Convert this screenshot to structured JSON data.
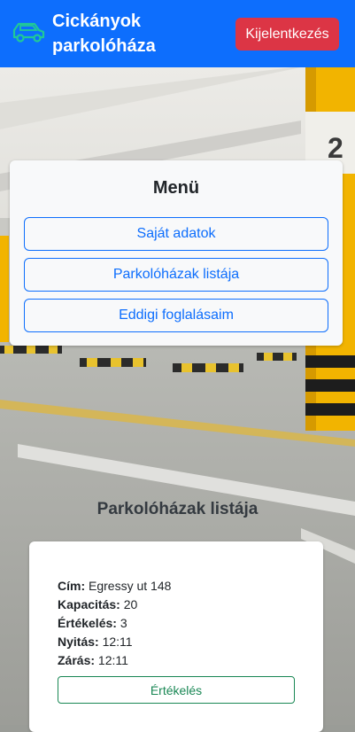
{
  "header": {
    "brand_line1": "Cickányok",
    "brand_line2": "parkolóháza",
    "brand_icon": "car-icon",
    "logout_label": "Kijelentkezés"
  },
  "menu": {
    "title": "Menü",
    "items": [
      {
        "label": "Saját adatok"
      },
      {
        "label": "Parkolóházak listája"
      },
      {
        "label": "Eddigi foglalásaim"
      }
    ]
  },
  "list": {
    "title": "Parkolóházak listája",
    "garages": [
      {
        "address_label": "Cím:",
        "address": "Egressy ut 148",
        "capacity_label": "Kapacitás:",
        "capacity": "20",
        "rating_label": "Értékelés:",
        "rating": "3",
        "opening_label": "Nyitás:",
        "opening": "12:11",
        "closing_label": "Zárás:",
        "closing": "12:11",
        "rate_button": "Értékelés"
      }
    ]
  },
  "background": {
    "pillar_number": "2"
  },
  "colors": {
    "primary": "#0d6efd",
    "danger": "#dc3545",
    "success": "#198754",
    "brand_icon": "#20c997"
  }
}
